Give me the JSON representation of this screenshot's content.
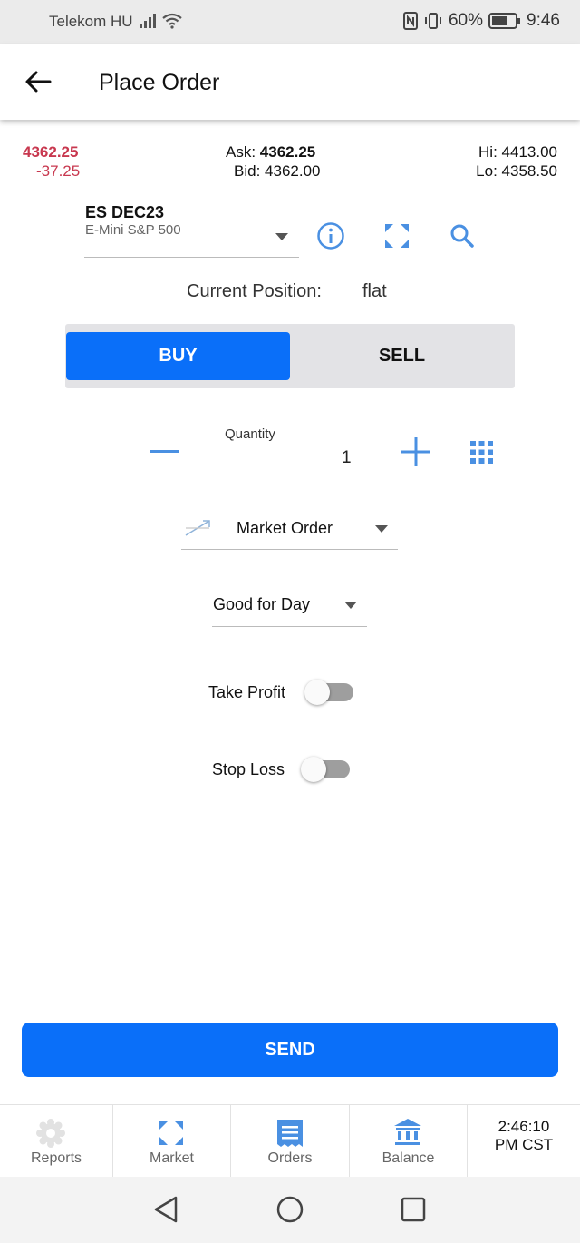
{
  "status_bar": {
    "carrier": "Telekom HU",
    "battery": "60%",
    "time": "9:46"
  },
  "app_bar": {
    "title": "Place Order"
  },
  "quote": {
    "last": "4362.25",
    "change": "-37.25",
    "ask_label": "Ask:",
    "ask": "4362.25",
    "bid_label": "Bid:",
    "bid": "4362.00",
    "hi_label": "Hi:",
    "hi": "4413.00",
    "lo_label": "Lo:",
    "lo": "4358.50"
  },
  "instrument": {
    "symbol": "ES DEC23",
    "description": "E-Mini S&P 500"
  },
  "position": {
    "label": "Current Position:",
    "value": "flat"
  },
  "side": {
    "buy_label": "BUY",
    "sell_label": "SELL",
    "selected": "BUY"
  },
  "quantity": {
    "label": "Quantity",
    "value": "1"
  },
  "order_type": {
    "value": "Market Order"
  },
  "duration": {
    "value": "Good for Day"
  },
  "take_profit": {
    "label": "Take Profit",
    "enabled": false
  },
  "stop_loss": {
    "label": "Stop Loss",
    "enabled": false
  },
  "send_label": "SEND",
  "bottom_nav": {
    "reports": "Reports",
    "market": "Market",
    "orders": "Orders",
    "balance": "Balance",
    "clock_time": "2:46:10",
    "clock_zone": "PM CST"
  },
  "colors": {
    "accent": "#0a6ff9",
    "negative": "#c8384f",
    "icon_blue": "#4a90e2"
  }
}
